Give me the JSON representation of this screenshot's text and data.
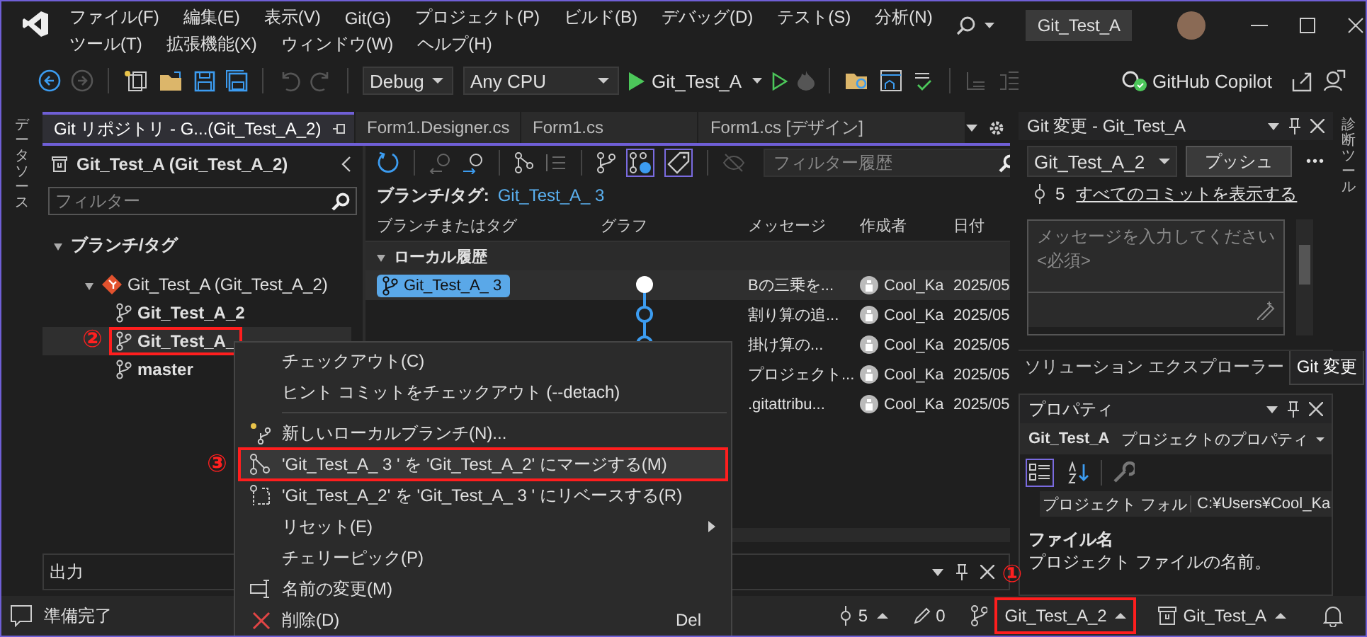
{
  "window": {
    "title": "Git_Test_A"
  },
  "menu_rows": [
    [
      "ファイル(F)",
      "編集(E)",
      "表示(V)",
      "Git(G)",
      "プロジェクト(P)",
      "ビルド(B)",
      "デバッグ(D)",
      "テスト(S)",
      "分析(N)"
    ],
    [
      "ツール(T)",
      "拡張機能(X)",
      "ウィンドウ(W)",
      "ヘルプ(H)"
    ]
  ],
  "toolbar": {
    "configuration": "Debug",
    "platform": "Any CPU",
    "startup": "Git_Test_A",
    "copilot": "GitHub Copilot"
  },
  "left_strip": "データソース",
  "right_strip": "診断ツール",
  "doc_tabs": [
    {
      "label": "Git リポジトリ - G...(Git_Test_A_2)",
      "selected": true
    },
    {
      "label": "Form1.Designer.cs",
      "selected": false
    },
    {
      "label": "Form1.cs",
      "selected": false
    },
    {
      "label": "Form1.cs [デザイン]",
      "selected": false
    }
  ],
  "repo_pane": {
    "title": "Git_Test_A (Git_Test_A_2)",
    "filter_placeholder": "フィルター",
    "tree": [
      {
        "label": "ブランチ/タグ",
        "expanded": true,
        "children": [
          {
            "label": "Git_Test_A (Git_Test_A_2)",
            "expanded": true,
            "children": [
              {
                "label": "Git_Test_A_2",
                "selected": false,
                "highlighted": false
              },
              {
                "label": "Git_Test_A_",
                "selected": true,
                "highlighted": true,
                "annotation": "②"
              },
              {
                "label": "master",
                "selected": false,
                "highlighted": false
              }
            ]
          }
        ]
      }
    ]
  },
  "history": {
    "filter_placeholder": "フィルター履歴",
    "branch_label": "ブランチ/タグ:",
    "branch_value": "Git_Test_A_ 3",
    "columns": [
      "ブランチまたはタグ",
      "グラフ",
      "メッセージ",
      "作成者",
      "日付"
    ],
    "group": "ローカル履歴",
    "group_expanded": true,
    "rows": [
      {
        "tag": "Git_Test_A_ 3",
        "message": "Bの三乗を...",
        "author": "Cool_Ka",
        "date": "2025/05",
        "selected": true
      },
      {
        "message": "割り算の追...",
        "author": "Cool_Ka",
        "date": "2025/05",
        "selected": false
      },
      {
        "message": "掛け算の...",
        "author": "Cool_Ka",
        "date": "2025/05",
        "selected": false
      },
      {
        "message": "プロジェクト...",
        "author": "Cool_Ka",
        "date": "2025/05",
        "selected": false
      },
      {
        "message": ".gitattribu...",
        "author": "Cool_Ka",
        "date": "2025/05",
        "selected": false
      }
    ]
  },
  "git_changes": {
    "title": "Git 変更 - Git_Test_A",
    "branch": "Git_Test_A_2",
    "push": "プッシュ",
    "more": "•••",
    "commit_count": "5",
    "all_commits_link": "すべてのコミットを表示する",
    "message_placeholder": "メッセージを入力してください <必須>",
    "tabs": [
      {
        "label": "ソリューション エクスプローラー",
        "selected": false
      },
      {
        "label": "Git 変更",
        "selected": true
      }
    ]
  },
  "properties": {
    "title": "プロパティ",
    "object_name": "Git_Test_A",
    "object_type": "プロジェクトのプロパティ",
    "rows": [
      {
        "name": "プロジェクト フォル",
        "value": "C:¥Users¥Cool_Ka"
      }
    ],
    "description_title": "ファイル名",
    "description": "プロジェクト ファイルの名前。"
  },
  "output": {
    "title": "出力"
  },
  "context_menu": [
    {
      "kind": "plain",
      "label": "チェックアウト(C)"
    },
    {
      "kind": "plain",
      "label": "ヒント コミットをチェックアウト (--detach)"
    },
    {
      "kind": "separator"
    },
    {
      "kind": "new-branch",
      "label": "新しいローカルブランチ(N)..."
    },
    {
      "kind": "merge",
      "label": "'Git_Test_A_ 3 ' を 'Git_Test_A_2' にマージする(M)",
      "highlighted": true,
      "annotation": "③"
    },
    {
      "kind": "rebase",
      "label": "'Git_Test_A_2' を 'Git_Test_A_ 3 ' にリベースする(R)"
    },
    {
      "kind": "submenu",
      "label": "リセット(E)"
    },
    {
      "kind": "plain",
      "label": "チェリーピック(P)"
    },
    {
      "kind": "rename",
      "label": "名前の変更(M)"
    },
    {
      "kind": "delete",
      "label": "削除(D)",
      "shortcut": "Del"
    }
  ],
  "status_bar": {
    "message": "準備完了",
    "commits": "5",
    "changes": "0",
    "branch": "Git_Test_A_2",
    "branch_highlighted": true,
    "branch_annotation": "①",
    "repo": "Git_Test_A"
  }
}
